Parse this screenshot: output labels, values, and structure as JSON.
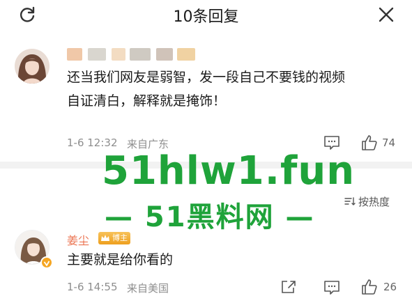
{
  "header": {
    "title": "10条回复",
    "refresh_icon": "refresh-icon",
    "close_icon": "close-icon"
  },
  "first_comment": {
    "text_line1": "还当我们网友是弱智，发一段自己不要钱的视频",
    "text_line2": "自证清白，解释就是掩饰！",
    "time": "1-6 12:32",
    "location": "来自广东",
    "like_count": "74"
  },
  "sort": {
    "label": "按热度",
    "icon": "sort-icon"
  },
  "watermark": {
    "main": "51hlw1.fun",
    "sub": "— 51黑料网 —",
    "color": "#1fa33a"
  },
  "reply": {
    "username": "姜尘",
    "badge": "博主",
    "text": "主要就是给你看的",
    "time": "1-6 14:55",
    "location": "来自美国",
    "like_count": "26"
  },
  "colors": {
    "username": "#eb7350",
    "meta": "#8e8e8e",
    "separator": "#f2f2f2"
  }
}
